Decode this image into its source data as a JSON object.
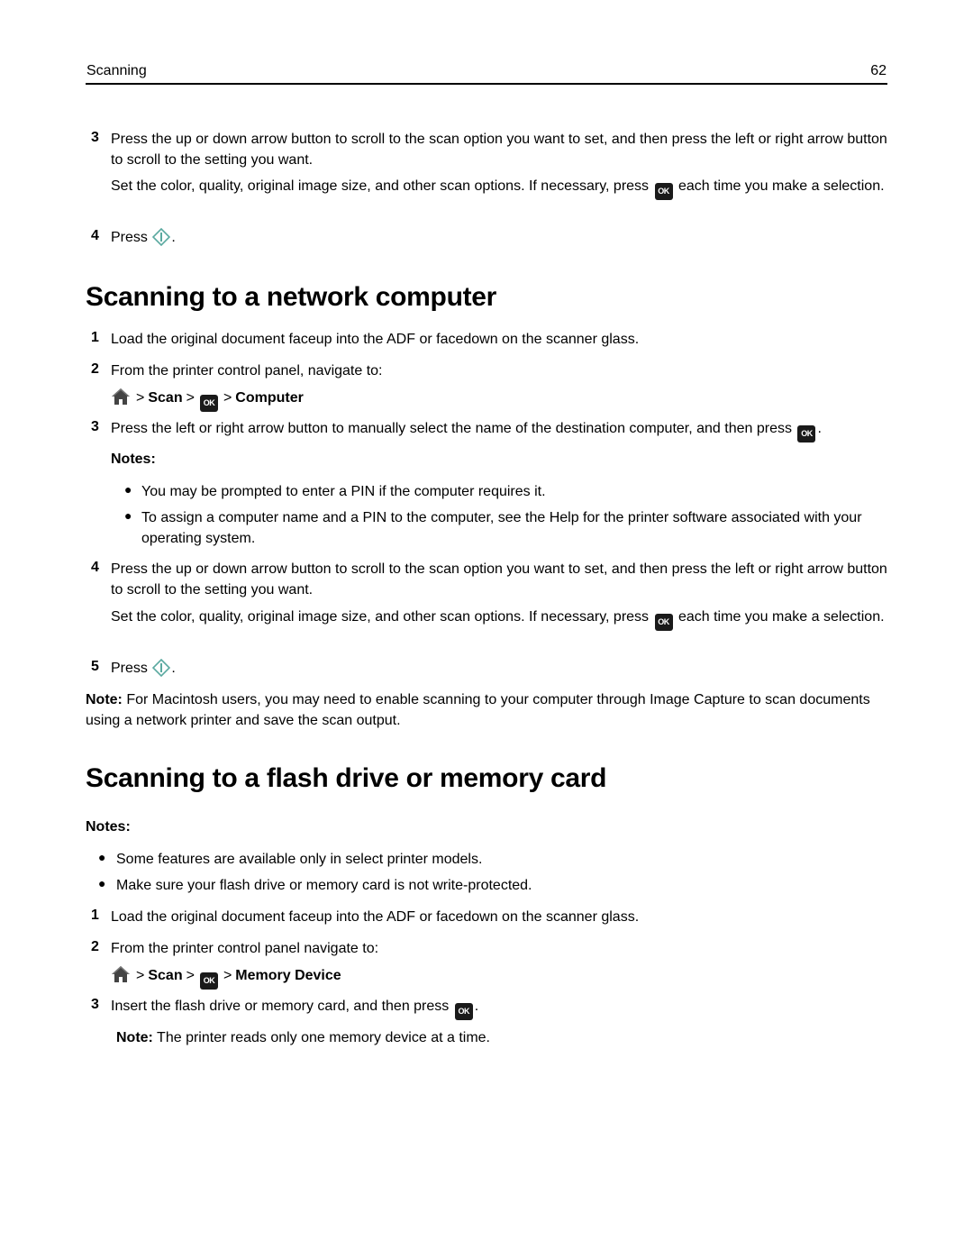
{
  "header": {
    "section": "Scanning",
    "page_number": "62"
  },
  "intro_steps": [
    {
      "num": "3",
      "text": "Press the up or down arrow button to scroll to the scan option you want to set, and then press the left or right arrow button to scroll to the setting you want.",
      "sub_before": "Set the color, quality, original image size, and other scan options. If necessary, press",
      "sub_after": "each time you make a selection."
    },
    {
      "num": "4",
      "text_before": "Press",
      "text_after": "."
    }
  ],
  "network": {
    "title": "Scanning to a network computer",
    "step1": {
      "num": "1",
      "text": "Load the original document faceup into the ADF or facedown on the scanner glass."
    },
    "step2": {
      "num": "2",
      "text": "From the printer control panel, navigate to:"
    },
    "path": {
      "sep": ">",
      "scan": "Scan",
      "ok": "OK",
      "target": "Computer"
    },
    "step3": {
      "num": "3",
      "text_before": "Press the left or right arrow button to manually select the name of the destination computer, and then press",
      "text_after": "."
    },
    "notes_label": "Notes:",
    "notes": [
      "You may be prompted to enter a PIN if the computer requires it.",
      "To assign a computer name and a PIN to the computer, see the Help for the printer software associated with your operating system."
    ],
    "step4": {
      "num": "4",
      "text": "Press the up or down arrow button to scroll to the scan option you want to set, and then press the left or right arrow button to scroll to the setting you want.",
      "sub_before": "Set the color, quality, original image size, and other scan options. If necessary, press",
      "sub_after": "each time you make a selection."
    },
    "step5": {
      "num": "5",
      "text_before": "Press",
      "text_after": "."
    },
    "mac_note_label": "Note:",
    "mac_note": "For Macintosh users, you may need to enable scanning to your computer through Image Capture to scan documents using a network printer and save the scan output."
  },
  "flash": {
    "title": "Scanning to a flash drive or memory card",
    "notes_label": "Notes:",
    "notes": [
      "Some features are available only in select printer models.",
      "Make sure your flash drive or memory card is not write-protected."
    ],
    "step1": {
      "num": "1",
      "text": "Load the original document faceup into the ADF or facedown on the scanner glass."
    },
    "step2": {
      "num": "2",
      "text": "From the printer control panel navigate to:"
    },
    "path": {
      "sep": ">",
      "scan": "Scan",
      "ok": "OK",
      "target": "Memory Device"
    },
    "step3": {
      "num": "3",
      "text_before": "Insert the flash drive or memory card, and then press",
      "text_after": "."
    },
    "final_note_label": "Note:",
    "final_note": "The printer reads only one memory device at a time."
  },
  "icons": {
    "ok": "ok-button-icon",
    "start": "start-button-icon",
    "home": "home-icon"
  },
  "colors": {
    "start_icon": "#5aa9a0",
    "ok_icon_bg": "#1a1a1a"
  }
}
